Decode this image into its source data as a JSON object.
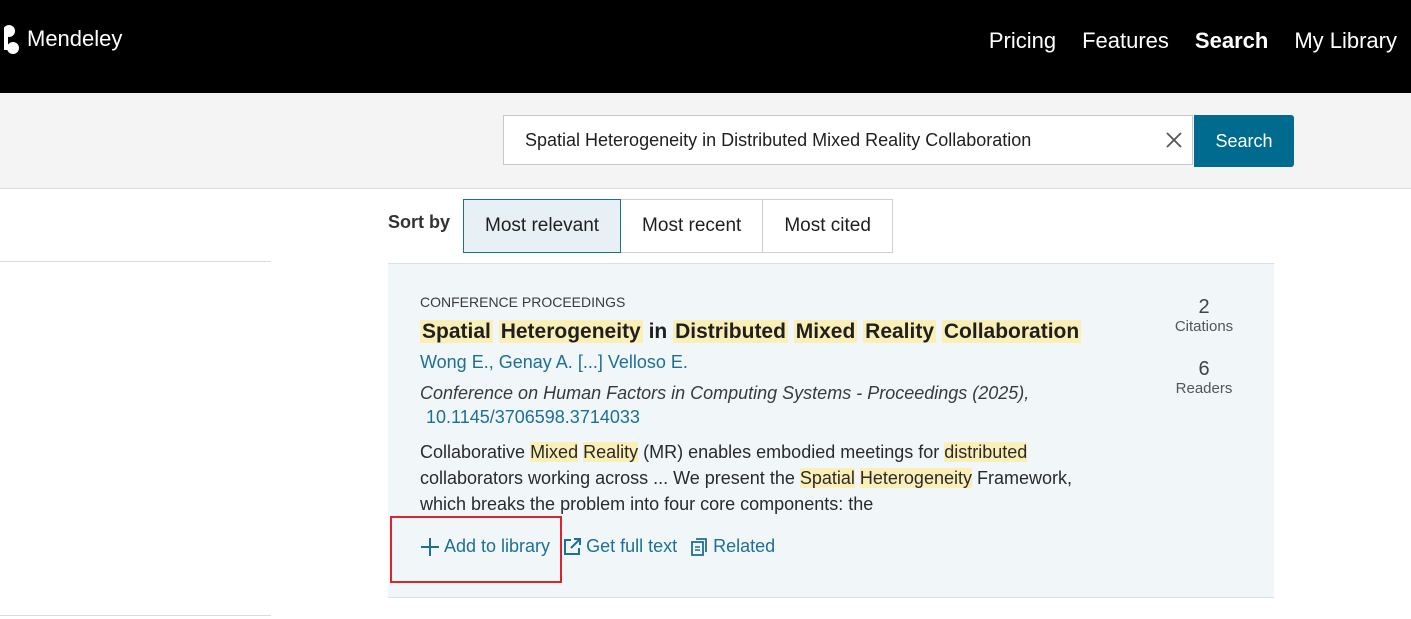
{
  "brand": {
    "name": "Mendeley"
  },
  "nav": {
    "items": [
      "Pricing",
      "Features",
      "Search",
      "My Library"
    ],
    "active": "Search"
  },
  "search": {
    "value": "Spatial Heterogeneity in Distributed Mixed Reality Collaboration",
    "button_label": "Search"
  },
  "sort": {
    "label": "Sort by",
    "options": [
      "Most relevant",
      "Most recent",
      "Most cited"
    ],
    "selected": "Most relevant"
  },
  "result": {
    "type": "CONFERENCE PROCEEDINGS",
    "title_parts": [
      {
        "text": "Spatial",
        "hl": true
      },
      {
        "text": "Heterogeneity",
        "hl": true
      },
      {
        "text": "in",
        "hl": false
      },
      {
        "text": "Distributed",
        "hl": true
      },
      {
        "text": "Mixed",
        "hl": true
      },
      {
        "text": "Reality",
        "hl": true
      },
      {
        "text": "Collaboration",
        "hl": true
      }
    ],
    "authors": {
      "first": "Wong E.",
      "second": "Genay A.",
      "ellipsis": "[...]",
      "last": "Velloso E."
    },
    "venue": "Conference on Human Factors in Computing Systems - Proceedings (2025),",
    "doi": "10.1145/3706598.3714033",
    "abstract_lines": [
      [
        {
          "t": "Collaborative ",
          "h": false
        },
        {
          "t": "Mixed",
          "h": true
        },
        {
          "t": " ",
          "h": false
        },
        {
          "t": "Reality",
          "h": true
        },
        {
          "t": " (MR) enables embodied meetings for ",
          "h": false
        },
        {
          "t": "distributed",
          "h": true
        }
      ],
      [
        {
          "t": "collaborators working across ... We present the ",
          "h": false
        },
        {
          "t": "Spatial",
          "h": true
        },
        {
          "t": " ",
          "h": false
        },
        {
          "t": "Heterogeneity",
          "h": true
        },
        {
          "t": " Framework,",
          "h": false
        }
      ],
      [
        {
          "t": "which breaks the problem into four core components: the",
          "h": false
        }
      ]
    ],
    "citations": {
      "count": "2",
      "label": "Citations"
    },
    "readers": {
      "count": "6",
      "label": "Readers"
    },
    "actions": {
      "add": "Add to library",
      "full_text": "Get full text",
      "related": "Related"
    }
  },
  "colors": {
    "accent": "#006b8f",
    "link": "#1d6f96",
    "highlight": "#fbefb8",
    "card_bg": "#f1f6f9",
    "annotation": "#d9252b"
  },
  "icons": [
    "mendeley-logo-icon",
    "close-icon",
    "plus-icon",
    "external-link-icon",
    "related-icon"
  ]
}
